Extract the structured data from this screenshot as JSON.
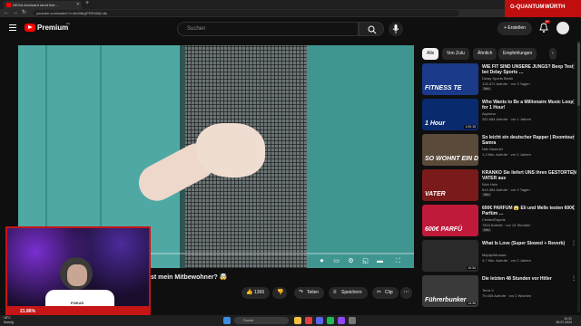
{
  "browser": {
    "tab_title": "DEGA dominant rannt hier…",
    "new_tab": "+",
    "url": "youtube.com/watch?v=6e5dbyjPRE98&t=8s"
  },
  "extension": {
    "logo1": "G-QUANTUM",
    "logo2": "WÜRTH"
  },
  "header": {
    "brand": "Premium",
    "region": "DE",
    "search_placeholder": "Suchen",
    "create_label": "Erstellen",
    "notification_count": "9+"
  },
  "video": {
    "progress": 0.03,
    "title": "ist mein Mitbewohner? 🤯",
    "actions": {
      "like_count": "1366",
      "share": "Teilen",
      "save": "Speichern",
      "clip": "Clip"
    }
  },
  "cam": {
    "brand": "FOKUS",
    "percent": "21.86%"
  },
  "chips": [
    "Alle",
    "Von Zulu",
    "Ähnlich",
    "Empfehlungen"
  ],
  "recommendations": [
    {
      "title": "WIE FIT SIND UNSERE JUNGS? Beep Test bei Delay Sports …",
      "channel": "Delay Sports Berlin",
      "meta": "126.471 Aufrufe · vor 3 Tagen",
      "badge": "Neu",
      "duration": "",
      "thumb_text": "FITNESS TE",
      "thumb_color": "#1b3a8a"
    },
    {
      "title": "Who Wants to Be a Millionaire Music Loop for 1 Hour!",
      "channel": "Aquinna",
      "meta": "252.684 Aufrufe · vor 1 Jahren",
      "badge": "",
      "duration": "1:00:15",
      "thumb_text": "1 Hour",
      "thumb_color": "#0a2a6e"
    },
    {
      "title": "So leicht ein deutscher Rapper | Roomtour Samra",
      "channel": "Nils Hammer",
      "meta": "1,3 Mio. Aufrufe · vor 2 Jahren",
      "badge": "",
      "duration": "",
      "thumb_text": "SO WOHNT EIN DEUTSCHER RAP",
      "thumb_color": "#5a4a3a"
    },
    {
      "title": "KRANKO Sie liefert UNS ihren GESTÖRTEN VATER aus",
      "channel": "Nick Hein",
      "meta": "814.384 Aufrufe · vor 2 Tagen",
      "badge": "Neu",
      "duration": "",
      "thumb_text": "VATER",
      "thumb_color": "#7a1a1a"
    },
    {
      "title": "600€ PARFÜM 😱 Eli und Melle testen 600€ Parfüm …",
      "channel": "ChristofTayrde",
      "meta": "7824 Aufrufe · vor 14 Stunden",
      "badge": "Neu",
      "duration": "",
      "thumb_text": "600€ PARFÜ",
      "thumb_color": "#c01a3a"
    },
    {
      "title": "What Is Love (Super Slowed + Reverb)",
      "channel": "Mejrija/Mussier",
      "meta": "4,7 Mio. Aufrufe · vor 2 Jahren",
      "badge": "",
      "duration": "10:34",
      "thumb_text": "",
      "thumb_color": "#2a2a2a"
    },
    {
      "title": "Die letzten 48 Stunden vor Hitler",
      "channel": "Terra X",
      "meta": "79.405 Aufrufe · vor 2 Wochen",
      "badge": "",
      "duration": "14:36",
      "thumb_text": "Führerbunker",
      "thumb_color": "#3a3a3a"
    }
  ],
  "taskbar": {
    "weather_temp": "18°C",
    "weather_text": "Sonnig",
    "search": "Suche",
    "time": "10:31",
    "date": "05.07.2024"
  },
  "colors": {
    "accent": "#ff0000",
    "bg": "#0f0f0f",
    "chip_active": "#f1f1f1",
    "overlay_red": "#c51515"
  }
}
